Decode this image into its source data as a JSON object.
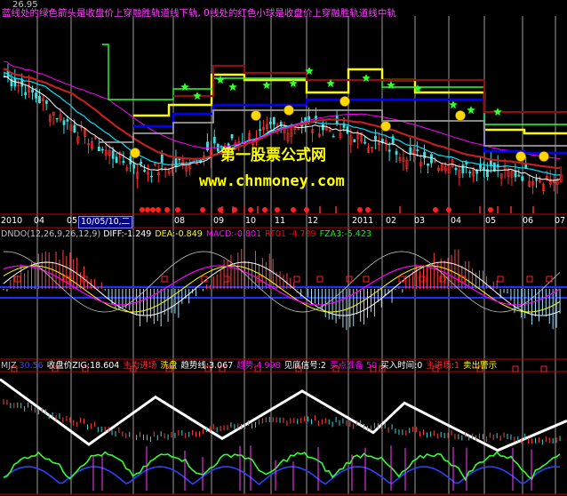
{
  "main_panel": {
    "price_label": "26.95",
    "caption": "蓝线处的绿色箭头是收盘价上穿融胜轨道线下轨, 0线处的红色小球是收盘价上穿融胜轨道线中轨"
  },
  "date_axis": {
    "labels": [
      "2010",
      "04",
      "05",
      "10/05/10,二",
      "08",
      "09",
      "10",
      "11",
      "12",
      "2011",
      "02",
      "03",
      "04",
      "05",
      "06",
      "07"
    ]
  },
  "watermark": {
    "line1": "第一股票公式网",
    "line2": "www.chnmoney.com"
  },
  "macd_panel": {
    "name": "DNDO(12,26,9,26,12,9)",
    "items": [
      {
        "text": "DIFF:-1.249",
        "color": "#ffffff"
      },
      {
        "text": "DEA:-0.849",
        "color": "#ffff00"
      },
      {
        "text": "MACD:-0.801",
        "color": "#ff00ff"
      },
      {
        "text": "RT01 -4.739",
        "color": "#ff0000"
      },
      {
        "text": "FZA3:-5.423",
        "color": "#00ff00"
      }
    ]
  },
  "zig_panel": {
    "name": "MJZ",
    "items": [
      {
        "text": "30.56",
        "color": "#4040ff"
      },
      {
        "text": "收盘价ZIG:18.604",
        "color": "#ffffff"
      },
      {
        "text": "主力进场",
        "color": "#ff3030"
      },
      {
        "text": "洗盘",
        "color": "#ffff00"
      },
      {
        "text": "趋势线:3.067",
        "color": "#ffffff"
      },
      {
        "text": "趋势:4.998",
        "color": "#ff00ff"
      },
      {
        "text": "见底信号:2",
        "color": "#ffffff"
      },
      {
        "text": "买点准备 50",
        "color": "#ff00ff"
      },
      {
        "text": "买入时间:0",
        "color": "#ffffff"
      },
      {
        "text": "主进场:1",
        "color": "#ff3030"
      },
      {
        "text": "卖出警示",
        "color": "#ffff00"
      }
    ]
  },
  "chart_data": {
    "type": "line",
    "title": "",
    "series": [
      {
        "values": [
          26.9,
          25.8,
          24.1,
          22.7,
          21.2,
          20.0,
          19.4,
          19.8,
          20.5,
          21.3,
          22.0,
          22.6,
          23.1,
          22.9,
          22.4,
          21.8,
          21.2,
          20.6,
          20.1,
          19.8,
          19.5,
          19.2,
          19.0,
          18.6
        ]
      }
    ],
    "zig_pivots": [
      30,
      19,
      27,
      20,
      28,
      21,
      26,
      18,
      23
    ],
    "ylim": [
      16,
      31
    ],
    "macd_ylim": [
      -6,
      6
    ],
    "grid": false
  },
  "colors": {
    "background": "#000000",
    "axis_red": "#c00000",
    "grid_vertical": "#cfcfcf",
    "zig_line": "#ffffff",
    "rail_yellow": "#ffff00",
    "rail_blue": "#0000ff",
    "caption_magenta": "#ff40ff"
  }
}
